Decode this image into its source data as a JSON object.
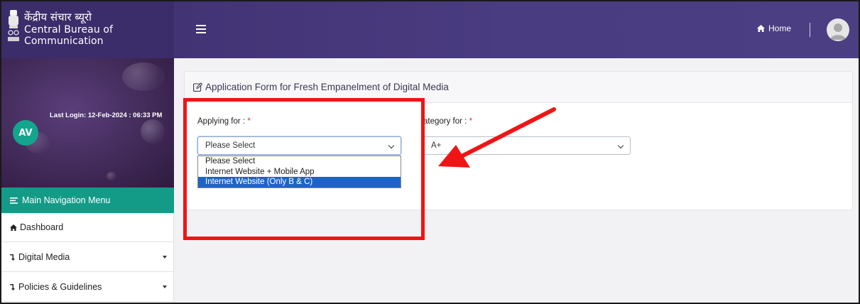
{
  "header": {
    "brand_hindi": "केंद्रीय संचार ब्यूरो",
    "brand_english": "Central Bureau of Communication",
    "home_label": "Home"
  },
  "sidebar": {
    "user_initials": "AV",
    "last_login": "Last Login: 12-Feb-2024 : 06:33 PM",
    "nav_header": "Main Navigation Menu",
    "items": [
      {
        "label": "Dashboard",
        "has_caret": false
      },
      {
        "label": "Digital Media",
        "has_caret": true
      },
      {
        "label": "Policies & Guidelines",
        "has_caret": true
      }
    ]
  },
  "form": {
    "title": "Application Form for Fresh Empanelment of Digital Media",
    "applying_label": "Applying for :",
    "applying_value": "Please Select",
    "applying_options": [
      "Please Select",
      "Internet Website + Mobile App",
      "Internet Website (Only B & C)"
    ],
    "applying_highlighted_option": "Internet Website (Only B & C)",
    "category_label": "ategory for :",
    "category_value": "A+",
    "required_mark": "*"
  },
  "colors": {
    "topbar": "#4a3c80",
    "nav_header": "#149b87",
    "avatar": "#13a58d",
    "annotation": "#f01414",
    "option_highlight": "#1e64c8"
  }
}
